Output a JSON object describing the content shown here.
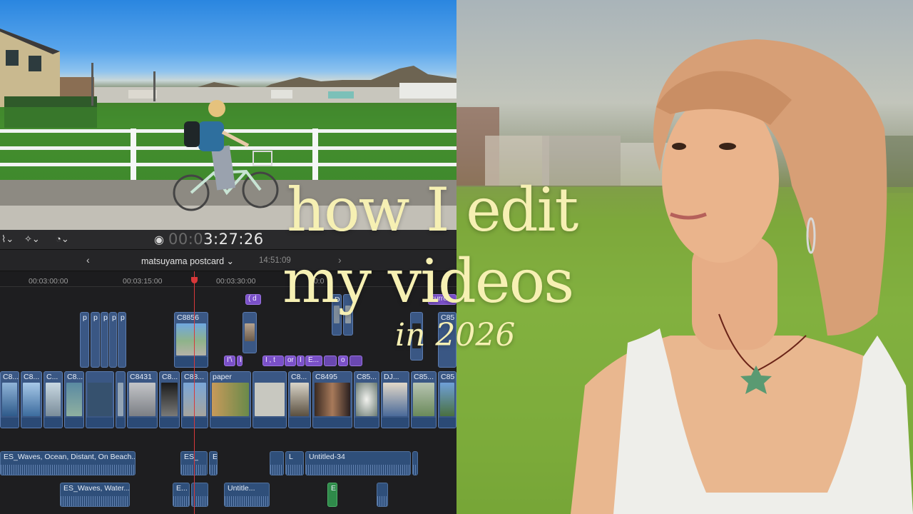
{
  "overlay_title": {
    "line1": "how I edit",
    "line2": "my videos",
    "line3": "in 2026",
    "color": "#f6f0b3"
  },
  "editor": {
    "timecode_dim": "00:0",
    "timecode": "3:27:26",
    "project_name": "matsuyama postcard",
    "project_duration": "14:51:09",
    "back_icon": "‹",
    "forward_icon": "›",
    "ruler_ticks": [
      "00:03:00:00",
      "00:03:15:00",
      "00:03:30:00",
      "00:0"
    ],
    "connected_clips": [
      {
        "label": "p"
      },
      {
        "label": "p"
      },
      {
        "label": "p"
      },
      {
        "label": "p"
      },
      {
        "label": "p"
      },
      {
        "label": "p"
      },
      {
        "label": "C8856"
      },
      {
        "label": "D"
      },
      {
        "label": "C85"
      }
    ],
    "title_clips": [
      "( d",
      "I'\\",
      "I",
      "I , t",
      "or",
      "I",
      "E...",
      "o",
      "curren"
    ],
    "primary_clips": [
      "C8...",
      "C8...",
      "C...",
      "C8...",
      "C8431",
      "C8...",
      "C88...",
      "paper",
      "C8...",
      "C8495",
      "C85...",
      "DJ...",
      "C85...",
      "C85"
    ],
    "audio_clips_row1": [
      "ES_Waves, Ocean, Distant, On Beach...",
      "ES_",
      "E",
      "L",
      "Untitled-34"
    ],
    "audio_clips_row2": [
      "ES_Waves, Water...",
      "E...",
      "Untitle...",
      "E"
    ]
  },
  "colors": {
    "clip_blue": "#3a5784",
    "title_purple": "#7a50c8",
    "playhead_red": "#d8383a",
    "timeline_bg": "#1e1e20"
  }
}
